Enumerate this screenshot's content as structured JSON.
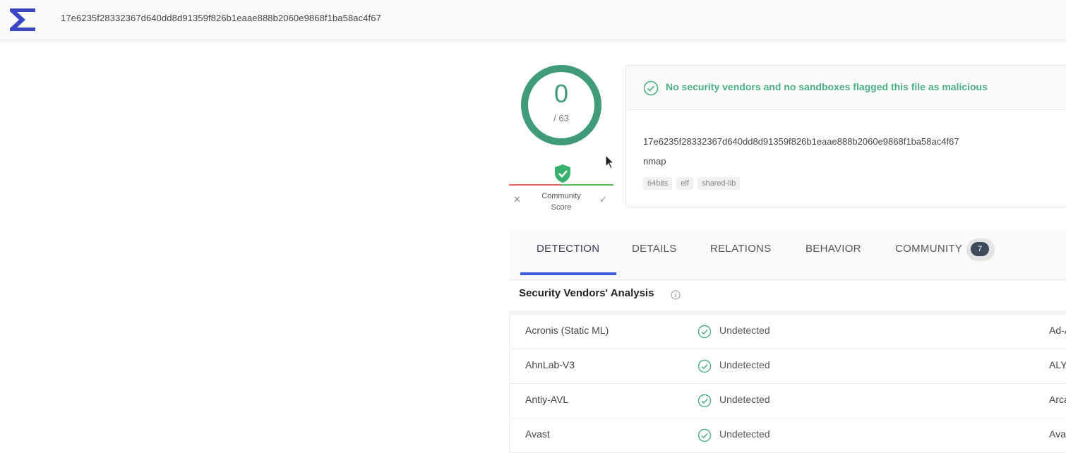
{
  "header": {
    "search_value": "17e6235f28332367d640dd8d91359f826b1eaae888b2060e9868f1ba58ac4f67",
    "logo_icon": "sigma-logo-icon"
  },
  "score": {
    "detections": "0",
    "total": "/ 63",
    "community_label_line1": "Community",
    "community_label_line2": "Score",
    "community_badge_icon": "shield-check-icon",
    "ring_color": "#3f9b78"
  },
  "summary": {
    "status_text": "No security vendors and no sandboxes flagged this file as malicious",
    "status_icon": "check-circle-icon",
    "hash": "17e6235f28332367d640dd8d91359f826b1eaae888b2060e9868f1ba58ac4f67",
    "file_name": "nmap",
    "tags": [
      "64bits",
      "elf",
      "shared-lib"
    ],
    "status_color": "#4dae80"
  },
  "tabs": {
    "items": [
      {
        "label": "DETECTION"
      },
      {
        "label": "DETAILS"
      },
      {
        "label": "RELATIONS"
      },
      {
        "label": "BEHAVIOR"
      },
      {
        "label": "COMMUNITY"
      }
    ],
    "community_count": "7",
    "active_color": "#3b5bdb"
  },
  "section": {
    "title": "Security Vendors' Analysis"
  },
  "vendors": [
    {
      "name": "Acronis (Static ML)",
      "result": "Undetected",
      "right": "Ad-A"
    },
    {
      "name": "AhnLab-V3",
      "result": "Undetected",
      "right": "ALY"
    },
    {
      "name": "Antiy-AVL",
      "result": "Undetected",
      "right": "Arca"
    },
    {
      "name": "Avast",
      "result": "Undetected",
      "right": "Ava"
    }
  ]
}
